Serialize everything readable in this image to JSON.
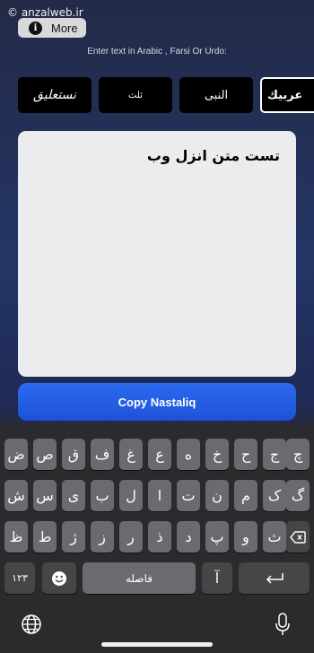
{
  "watermark": "© anzalweb.ir",
  "more_button": {
    "label": "More",
    "icon": "info-icon"
  },
  "instruction": "Enter text in Arabic , Farsi Or Urdo:",
  "font_options": [
    {
      "label": "نستعلیق",
      "style": "nastaliq"
    },
    {
      "label": "ثلث",
      "style": "thuluth"
    },
    {
      "label": "النبى",
      "style": "alnabi"
    },
    {
      "label": "عربيك",
      "style": "arabic",
      "selected": true
    }
  ],
  "text_input": {
    "value": "تست متن  انزل وب"
  },
  "copy_button": {
    "label": "Copy Nastaliq"
  },
  "keyboard": {
    "row1": [
      "ض",
      "ص",
      "ق",
      "ف",
      "غ",
      "ع",
      "ه",
      "خ",
      "ح",
      "ج",
      "چ"
    ],
    "row2": [
      "ش",
      "س",
      "ی",
      "ب",
      "ل",
      "ا",
      "ت",
      "ن",
      "م",
      "ک",
      "گ"
    ],
    "row3": [
      "ظ",
      "ط",
      "ژ",
      "ز",
      "ر",
      "ذ",
      "د",
      "پ",
      "و",
      "ث"
    ],
    "numbers_key": "۱۲۳",
    "space_key": "فاصله",
    "alt_key": "آ",
    "emoji_icon": "emoji-icon",
    "return_icon": "return-icon",
    "backspace_icon": "backspace-icon",
    "globe_icon": "globe-icon",
    "mic_icon": "microphone-icon"
  },
  "colors": {
    "copy_button": "#2c6af0",
    "key": "#6b6b6f",
    "key_dark": "#464649",
    "text_area": "#ececee"
  }
}
